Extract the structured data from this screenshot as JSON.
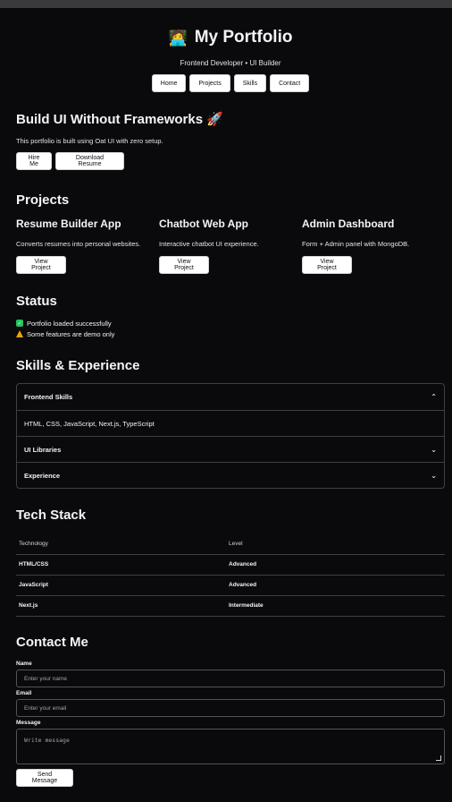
{
  "header": {
    "emoji": "🧑‍💻",
    "title": "My Portfolio",
    "subtitle": "Frontend Developer • UI Builder",
    "nav": [
      "Home",
      "Projects",
      "Skills",
      "Contact"
    ]
  },
  "hero": {
    "heading": "Build UI Without Frameworks 🚀",
    "text": "This portfolio is built using Oat UI with zero setup.",
    "buttons": [
      "Hire Me",
      "Download Resume"
    ]
  },
  "projects": {
    "heading": "Projects",
    "items": [
      {
        "title": "Resume Builder App",
        "desc": "Converts resumes into personal websites.",
        "button": "View Project"
      },
      {
        "title": "Chatbot Web App",
        "desc": "Interactive chatbot UI experience.",
        "button": "View Project"
      },
      {
        "title": "Admin Dashboard",
        "desc": "Form + Admin panel with MongoDB.",
        "button": "View Project"
      }
    ]
  },
  "status": {
    "heading": "Status",
    "items": [
      "Portfolio loaded successfully",
      "Some features are demo only"
    ]
  },
  "skills": {
    "heading": "Skills & Experience",
    "sections": [
      {
        "label": "Frontend Skills",
        "content": "HTML, CSS, JavaScript, Next.js, TypeScript"
      },
      {
        "label": "UI Libraries"
      },
      {
        "label": "Experience"
      }
    ]
  },
  "tech": {
    "heading": "Tech Stack",
    "columns": [
      "Technology",
      "Level"
    ],
    "rows": [
      [
        "HTML/CSS",
        "Advanced"
      ],
      [
        "JavaScript",
        "Advanced"
      ],
      [
        "Next.js",
        "Intermediate"
      ]
    ]
  },
  "contact": {
    "heading": "Contact Me",
    "name_label": "Name",
    "name_placeholder": "Enter your name",
    "email_label": "Email",
    "email_placeholder": "Enter your email",
    "message_label": "Message",
    "message_placeholder": "Write message",
    "send_label": "Send Message"
  },
  "colors": {
    "background": "#0a0a0c",
    "border": "#3f3f46",
    "success": "#22c55e",
    "warning": "#f59e0b"
  },
  "icons": [
    "checkbox-check-icon",
    "warning-icon",
    "chevron-up-icon",
    "chevron-down-icon",
    "rocket-icon"
  ]
}
